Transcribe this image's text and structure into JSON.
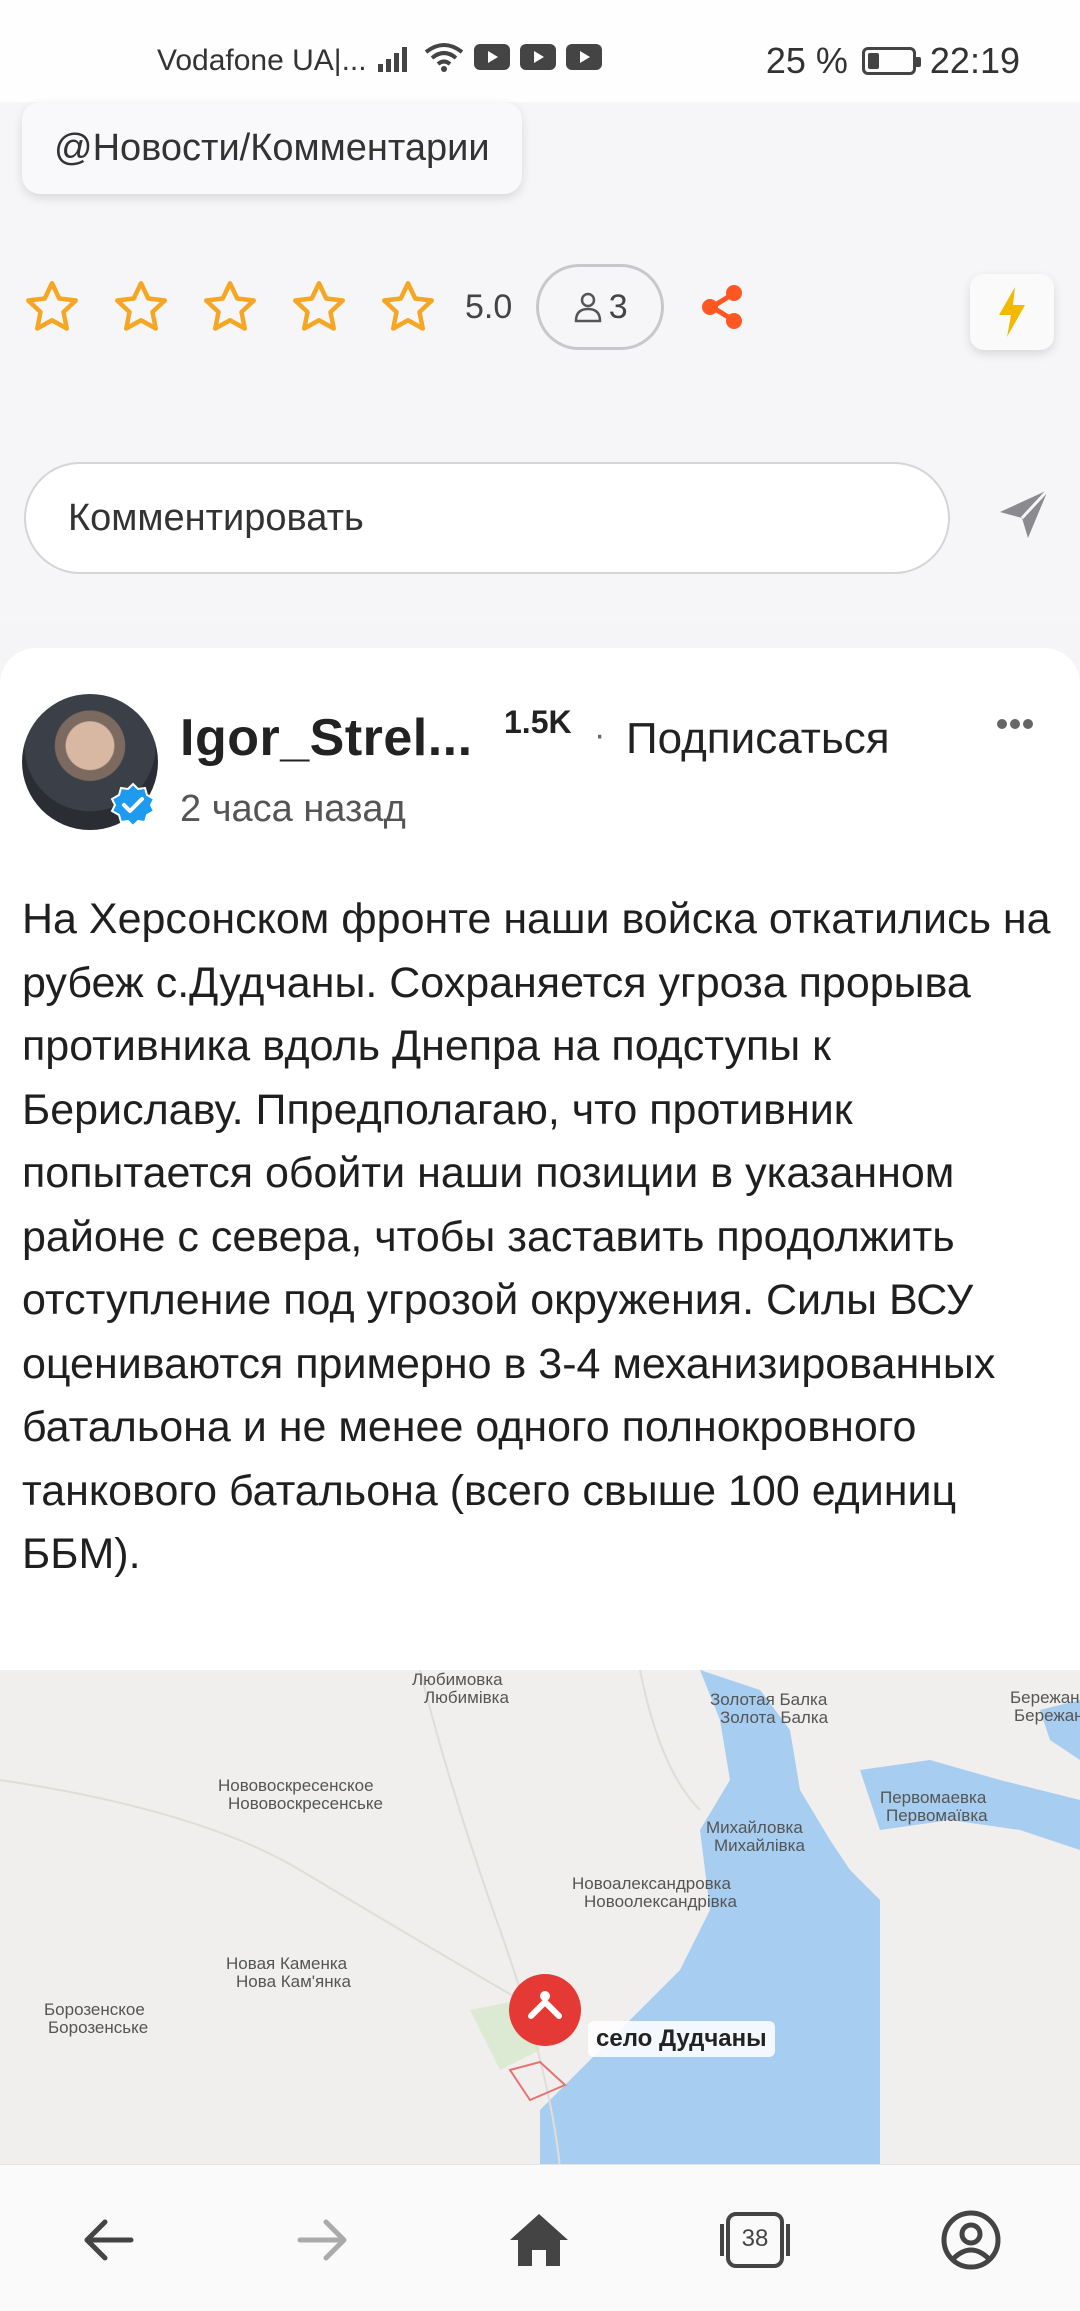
{
  "status_bar": {
    "carrier": "Vodafone UA|...",
    "battery": "25 %",
    "battery_level": 0.25,
    "time": "22:19"
  },
  "tag": {
    "label": "@Новости/Комментарии"
  },
  "rating": {
    "stars_filled": 0,
    "stars_total": 5,
    "value": "5.0",
    "reviewers": "3"
  },
  "comment": {
    "placeholder": "Комментировать"
  },
  "post": {
    "author": "Igor_Strel...",
    "followers": "1.5K",
    "separator": "·",
    "subscribe": "Подписаться",
    "time": "2 часа назад",
    "text": "На Херсонском фронте наши войска откатились на рубеж с.Дудчаны. Сохраняется угроза прорыва противника вдоль Днепра на подступы к Бериславу. Ппредполагаю, что противник попытается обойти наши позиции в указанном районе с севера, чтобы заставить продолжить отступление под угрозой окружения. Силы ВСУ оцениваются примерно в 3-4 механизированных батальона и не менее одного полнокровного танкового батальона (всего свыше 100 единиц ББМ)."
  },
  "map": {
    "labels": [
      "Любимовка",
      "Любимівка",
      "Золотая Балка",
      "Золота Балка",
      "Бережанка",
      "Бережанка",
      "Нововоскресенское",
      "Нововоскресенське",
      "Михайловка",
      "Михайлівка",
      "Первомаевка",
      "Первомаївка",
      "Новоалександровка",
      "Новоолександрівка",
      "Новая Каменка",
      "Нова Кам'янка",
      "Борозенское",
      "Борозенське"
    ],
    "pin_label": "село Дудчаны",
    "water_color": "#a7cdf0",
    "pin_color": "#e53935"
  },
  "nav": {
    "tabs_count": "38"
  },
  "colors": {
    "star": "#f5a623",
    "share": "#ff5722",
    "lightning": "#f5b800",
    "verified": "#1d9bf0"
  }
}
